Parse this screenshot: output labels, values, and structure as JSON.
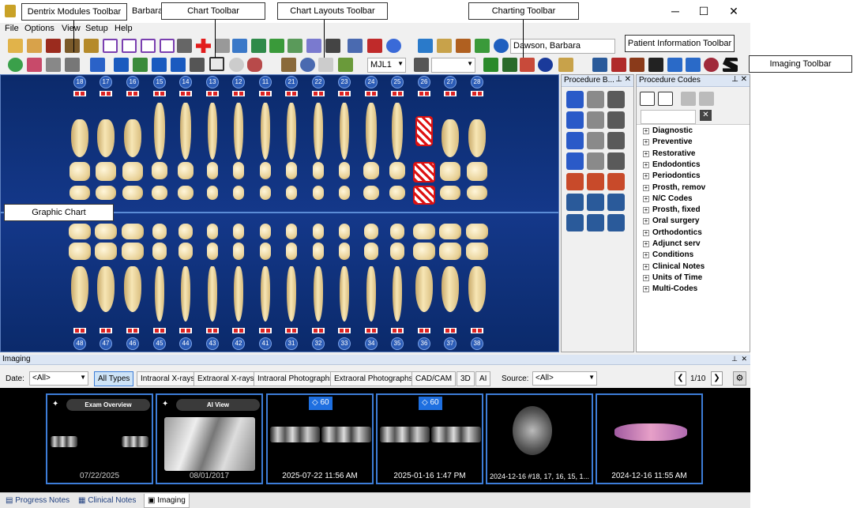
{
  "titlebar": {
    "title": "Barbara",
    "min": "─",
    "max": "☐",
    "close": "✕"
  },
  "menu": [
    "File",
    "Options",
    "View",
    "Setup",
    "Help"
  ],
  "toolbar": {
    "patient_combo": "Dawson, Barbara",
    "layout_combo": "MJL1",
    "blank_combo": ""
  },
  "chart": {
    "upper_numbers": [
      "18",
      "17",
      "16",
      "15",
      "14",
      "13",
      "12",
      "11",
      "21",
      "22",
      "23",
      "24",
      "25",
      "26",
      "27",
      "28"
    ],
    "lower_numbers": [
      "48",
      "47",
      "46",
      "45",
      "44",
      "43",
      "42",
      "41",
      "31",
      "32",
      "33",
      "34",
      "35",
      "36",
      "37",
      "38"
    ],
    "highlighted_tooth": "26"
  },
  "procedure_buttons": {
    "title": "Procedure B..."
  },
  "procedure_codes": {
    "title": "Procedure Codes",
    "categories": [
      "Diagnostic",
      "Preventive",
      "Restorative",
      "Endodontics",
      "Periodontics",
      "Prosth, remov",
      "N/C Codes",
      "Prosth, fixed",
      "Oral surgery",
      "Orthodontics",
      "Adjunct serv",
      "Conditions",
      "Clinical Notes",
      "Units of Time",
      "Multi-Codes"
    ]
  },
  "imaging": {
    "title": "Imaging",
    "date_label": "Date:",
    "date_value": "<All>",
    "filters": [
      "All Types",
      "Intraoral X-rays",
      "Extraoral X-rays",
      "Intraoral Photographs",
      "Extraoral Photographs",
      "CAD/CAM",
      "3D",
      "AI"
    ],
    "source_label": "Source:",
    "source_value": "<All>",
    "page": "1/10",
    "thumbs": [
      {
        "label": "Exam Overview",
        "date": "07/22/2025"
      },
      {
        "label": "AI View",
        "date": "08/01/2017",
        "alert": "!"
      },
      {
        "badge": "60",
        "date": "2025-07-22 11:56 AM"
      },
      {
        "badge": "60",
        "date": "2025-01-16 1:47 PM"
      },
      {
        "date": "2024-12-16 #18, 17, 16, 15, 1..."
      },
      {
        "date": "2024-12-16 11:55 AM"
      }
    ]
  },
  "bottom_tabs": [
    "Progress Notes",
    "Clinical Notes",
    "Imaging"
  ],
  "callouts": {
    "modules": "Dentrix Modules Toolbar",
    "chart_tb": "Chart Toolbar",
    "layouts": "Chart Layouts Toolbar",
    "charting": "Charting Toolbar",
    "patient_info": "Patient Information Toolbar",
    "imaging_tb": "Imaging Toolbar",
    "graphic": "Graphic Chart"
  }
}
